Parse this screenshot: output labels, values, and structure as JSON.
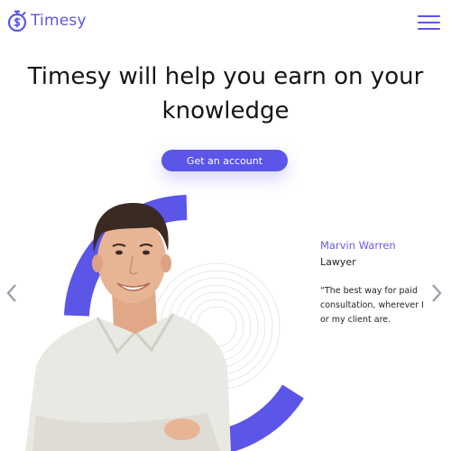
{
  "header": {
    "brand_name": "Timesy",
    "logo_icon": "stopwatch-dollar-icon",
    "menu_icon": "hamburger-menu-icon"
  },
  "hero": {
    "headline_line1": "Timesy will help you earn on your",
    "headline_line2": "knowledge",
    "cta_label": "Get an account"
  },
  "testimonial": {
    "name": "Marvin Warren",
    "role": "Lawyer",
    "quote_line1": "“The best way for paid",
    "quote_line2": "consultation, wherever I",
    "quote_line3": "or my client are.",
    "prev_icon": "chevron-left-icon",
    "next_icon": "chevron-right-icon"
  },
  "colors": {
    "accent": "#5b55e8",
    "name_color": "#6a5ce0",
    "arrow": "#9aa0ad",
    "shirt": "#e9e9e4",
    "skin": "#e8b594",
    "hair": "#3a2a22"
  }
}
